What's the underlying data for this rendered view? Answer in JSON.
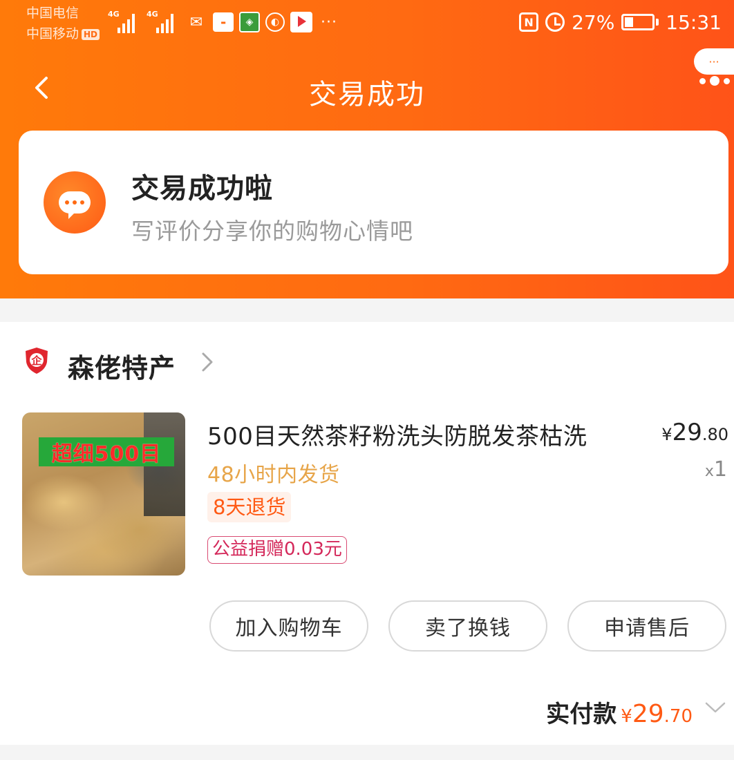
{
  "status_bar": {
    "carrier1": "中国电信",
    "carrier2": "中国移动",
    "hd": "HD",
    "net1": "4G",
    "net2": "4G",
    "battery_percent": "27%",
    "time": "15:31",
    "nfc": "N"
  },
  "nav": {
    "title": "交易成功"
  },
  "success": {
    "title": "交易成功啦",
    "subtitle": "写评价分享你的购物心情吧"
  },
  "shop": {
    "name": "森佬特产",
    "badge": "企"
  },
  "product": {
    "image_label": "超细500目",
    "title": "500目天然茶籽粉洗头防脱发茶枯洗",
    "price_symbol": "¥",
    "price_int": "29",
    "price_dec": ".80",
    "qty_x": "x",
    "qty": "1",
    "shipping": "48小时内发货",
    "return_policy": "8天退货",
    "charity": "公益捐赠0.03元"
  },
  "actions": {
    "add_cart": "加入购物车",
    "resell": "卖了换钱",
    "after_sale": "申请售后"
  },
  "total": {
    "label": "实付款",
    "symbol": "¥",
    "int": "29",
    "dec": ".70"
  },
  "colors": {
    "brand_orange": "#ff6a12",
    "price_orange": "#ff5a14",
    "shipping_gold": "#e7a549",
    "charity_red": "#d4285a"
  }
}
